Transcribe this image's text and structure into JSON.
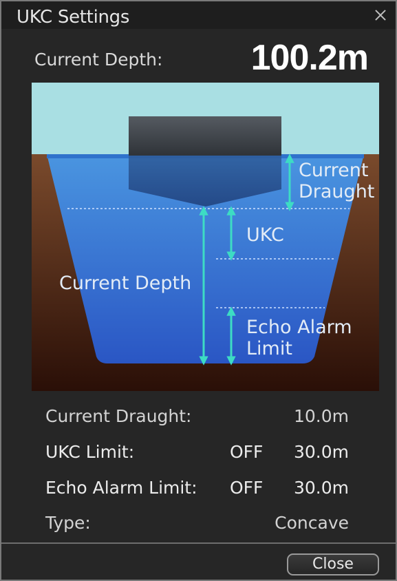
{
  "dialog": {
    "title": "UKC Settings",
    "close_icon": "close-x-icon"
  },
  "header": {
    "depth_label": "Current Depth:",
    "depth_value": "100.2m"
  },
  "diagram": {
    "labels": {
      "current_draught_line1": "Current",
      "current_draught_line2": "Draught",
      "ukc": "UKC",
      "current_depth": "Current Depth",
      "echo_line1": "Echo Alarm",
      "echo_line2": "Limit"
    },
    "colors": {
      "sky": "#a9dfe3",
      "water_top": "#4a95e0",
      "water_bottom": "#2a56c4",
      "seabed_top": "#7a4a2c",
      "seabed_bottom": "#2a0f07",
      "hull": "#3a4450",
      "arrow": "#3ddcc4"
    }
  },
  "settings": {
    "draught": {
      "label": "Current Draught:",
      "value": "10.0m"
    },
    "ukc_limit": {
      "label": "UKC Limit:",
      "state": "OFF",
      "value": "30.0m"
    },
    "echo_limit": {
      "label": "Echo Alarm Limit:",
      "state": "OFF",
      "value": "30.0m"
    },
    "type": {
      "label": "Type:",
      "value": "Concave"
    }
  },
  "footer": {
    "close_label": "Close"
  }
}
